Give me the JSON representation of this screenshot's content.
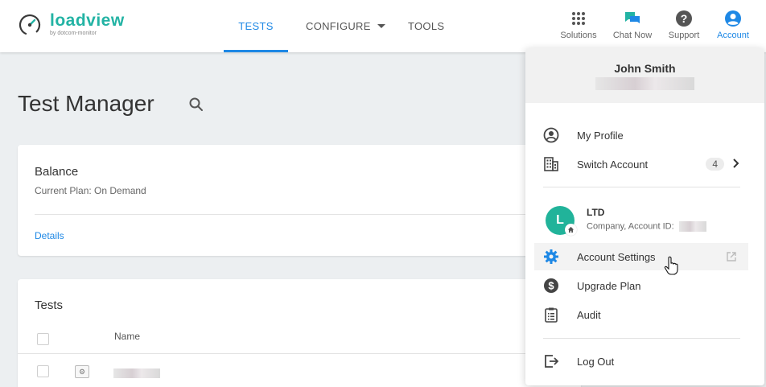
{
  "brand": {
    "name": "loadview",
    "tagline": "by dotcom-monitor",
    "color": "#23b3a4"
  },
  "nav": {
    "tests": "TESTS",
    "configure": "CONFIGURE",
    "tools": "TOOLS",
    "active_color": "#1e88e5"
  },
  "top_icons": {
    "solutions": "Solutions",
    "chat": "Chat Now",
    "support": "Support",
    "account": "Account"
  },
  "page": {
    "title": "Test Manager"
  },
  "balance": {
    "title": "Balance",
    "plan": "Current Plan: On Demand",
    "details": "Details"
  },
  "tests": {
    "title": "Tests",
    "column_name": "Name"
  },
  "account_menu": {
    "user_name": "John Smith",
    "my_profile": "My Profile",
    "switch_account": "Switch Account",
    "switch_count": "4",
    "company_initial": "L",
    "company_name": "LTD",
    "company_sub": "Company, Account ID:",
    "account_settings": "Account Settings",
    "upgrade_plan": "Upgrade Plan",
    "audit": "Audit",
    "log_out": "Log Out",
    "avatar_color": "#21b39a"
  }
}
